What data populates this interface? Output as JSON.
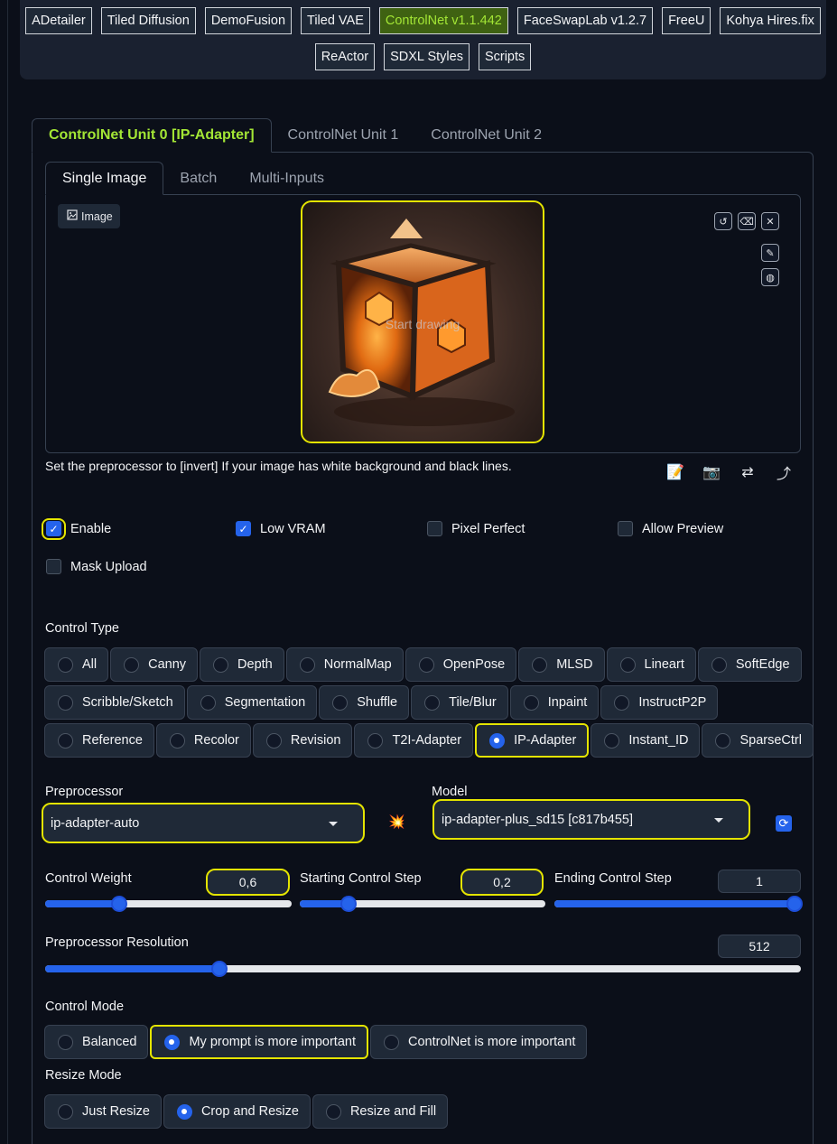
{
  "extensions": {
    "row1": [
      "ADetailer",
      "Tiled Diffusion",
      "DemoFusion",
      "Tiled VAE",
      "ControlNet v1.1.442",
      "FaceSwapLab v1.2.7",
      "FreeU",
      "Kohya Hires.fix"
    ],
    "row2": [
      "ReActor",
      "SDXL Styles",
      "Scripts"
    ],
    "active": "ControlNet v1.1.442"
  },
  "unit_tabs": [
    "ControlNet Unit 0 [IP-Adapter]",
    "ControlNet Unit 1",
    "ControlNet Unit 2"
  ],
  "image_tabs": [
    "Single Image",
    "Batch",
    "Multi-Inputs"
  ],
  "image_panel": {
    "label": "Image",
    "canvas_hint": "Start drawing"
  },
  "hint_text": "Set the preprocessor to [invert] If your image has white background and black lines.",
  "checkboxes": {
    "enable": {
      "label": "Enable",
      "checked": true
    },
    "low_vram": {
      "label": "Low VRAM",
      "checked": true
    },
    "pixel_perfect": {
      "label": "Pixel Perfect",
      "checked": false
    },
    "allow_preview": {
      "label": "Allow Preview",
      "checked": false
    },
    "mask_upload": {
      "label": "Mask Upload",
      "checked": false
    }
  },
  "control_type": {
    "label": "Control Type",
    "row1": [
      "All",
      "Canny",
      "Depth",
      "NormalMap",
      "OpenPose",
      "MLSD",
      "Lineart",
      "SoftEdge"
    ],
    "row2": [
      "Scribble/Sketch",
      "Segmentation",
      "Shuffle",
      "Tile/Blur",
      "Inpaint",
      "InstructP2P"
    ],
    "row3": [
      "Reference",
      "Recolor",
      "Revision",
      "T2I-Adapter",
      "IP-Adapter",
      "Instant_ID",
      "SparseCtrl"
    ],
    "selected": "IP-Adapter"
  },
  "preprocessor": {
    "label": "Preprocessor",
    "value": "ip-adapter-auto"
  },
  "model": {
    "label": "Model",
    "value": "ip-adapter-plus_sd15 [c817b455]"
  },
  "sliders": {
    "control_weight": {
      "label": "Control Weight",
      "value": "0,6",
      "fraction": 0.3
    },
    "starting_step": {
      "label": "Starting Control Step",
      "value": "0,2",
      "fraction": 0.2
    },
    "ending_step": {
      "label": "Ending Control Step",
      "value": "1",
      "fraction": 1.0
    },
    "preproc_resolution": {
      "label": "Preprocessor Resolution",
      "value": "512",
      "fraction": 0.23
    }
  },
  "control_mode": {
    "label": "Control Mode",
    "options": [
      "Balanced",
      "My prompt is more important",
      "ControlNet is more important"
    ],
    "selected": "My prompt is more important"
  },
  "resize_mode": {
    "label": "Resize Mode",
    "options": [
      "Just Resize",
      "Crop and Resize",
      "Resize and Fill"
    ],
    "selected": "Crop and Resize"
  },
  "colors": {
    "accent": "#2563eb",
    "highlight": "#e4e400",
    "active_tab": "#a3e635"
  }
}
